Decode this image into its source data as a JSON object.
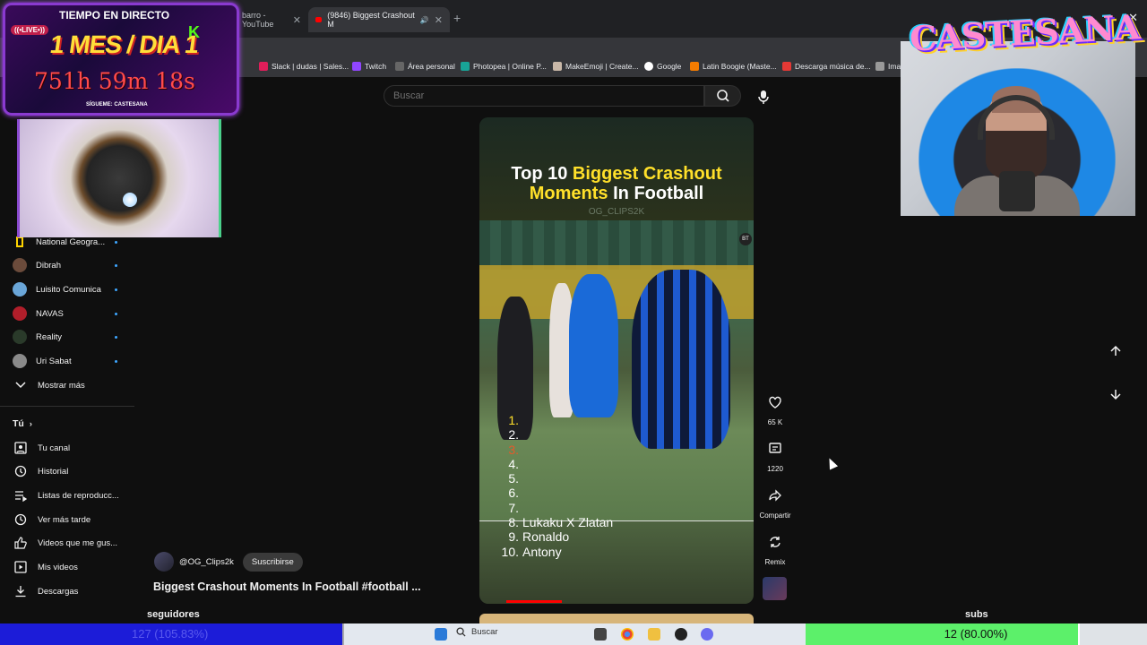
{
  "browser": {
    "tabs": [
      {
        "label": "barro - YouTube"
      },
      {
        "label": "(9846) Biggest Crashout M"
      }
    ],
    "new_tab": "+",
    "close": "✕",
    "bookmarks": [
      {
        "label": "Slack | dudas | Sales..."
      },
      {
        "label": "Twitch"
      },
      {
        "label": "Área personal"
      },
      {
        "label": "Photopea | Online P..."
      },
      {
        "label": "MakeEmoji | Create..."
      },
      {
        "label": "Google"
      },
      {
        "label": "Latin Boogie (Maste..."
      },
      {
        "label": "Descarga música de..."
      },
      {
        "label": "Imag"
      }
    ]
  },
  "header": {
    "search_placeholder": "Buscar"
  },
  "sidebar": {
    "subscriptions": [
      {
        "label": "National Geogra...",
        "color": "#ffd400"
      },
      {
        "label": "Dibrah",
        "color": "#6b4b3b"
      },
      {
        "label": "Luisito Comunica",
        "color": "#6aa6d8"
      },
      {
        "label": "NAVAS",
        "color": "#b01e2a"
      },
      {
        "label": "Reality",
        "color": "#2a3a2a"
      },
      {
        "label": "Uri Sabat",
        "color": "#8a8a8a"
      }
    ],
    "show_more": "Mostrar más",
    "you_heading": "Tú",
    "you_items": [
      {
        "label": "Tu canal",
        "icon": "channel-icon"
      },
      {
        "label": "Historial",
        "icon": "history-icon"
      },
      {
        "label": "Listas de reproducc...",
        "icon": "playlist-icon"
      },
      {
        "label": "Ver más tarde",
        "icon": "clock-icon"
      },
      {
        "label": "Videos que me gus...",
        "icon": "thumb-up-icon"
      },
      {
        "label": "Mis videos",
        "icon": "my-videos-icon"
      },
      {
        "label": "Descargas",
        "icon": "download-icon"
      }
    ]
  },
  "short": {
    "channel": "@OG_Clips2k",
    "subscribe": "Suscribirse",
    "title": "Biggest Crashout Moments In Football #football ...",
    "heading_white_1": "Top 10 ",
    "heading_yellow_1": "Biggest Crashout",
    "heading_yellow_2": "Moments",
    "heading_white_2": " In Football",
    "watermark": "OG_CLIPS2K",
    "badge": "BT",
    "list": [
      {
        "n": "1.",
        "text": ""
      },
      {
        "n": "2.",
        "text": ""
      },
      {
        "n": "3.",
        "text": ""
      },
      {
        "n": "4.",
        "text": ""
      },
      {
        "n": "5.",
        "text": ""
      },
      {
        "n": "6.",
        "text": ""
      },
      {
        "n": "7.",
        "text": ""
      },
      {
        "n": "8.",
        "text": "Lukaku X Zlatan"
      },
      {
        "n": "9.",
        "text": "Ronaldo"
      },
      {
        "n": "10.",
        "text": "Antony"
      }
    ],
    "likes": "65 K",
    "comments": "1220",
    "share": "Compartir",
    "remix": "Remix"
  },
  "overlay": {
    "live_heading": "TIEMPO EN DIRECTO",
    "live_tag": "((•LIVE•))",
    "kick": "K",
    "month": "1 MES / DIA 1",
    "timer": "751h 59m 18s",
    "follow": "SÍGUEME: CASTESANA",
    "logo": "CASTESANA",
    "followers_label": "seguidores",
    "followers_count": "127 (105.83%)",
    "subs_label": "subs",
    "subs_count": "12 (80.00%)"
  },
  "taskbar": {
    "search": "Buscar"
  }
}
